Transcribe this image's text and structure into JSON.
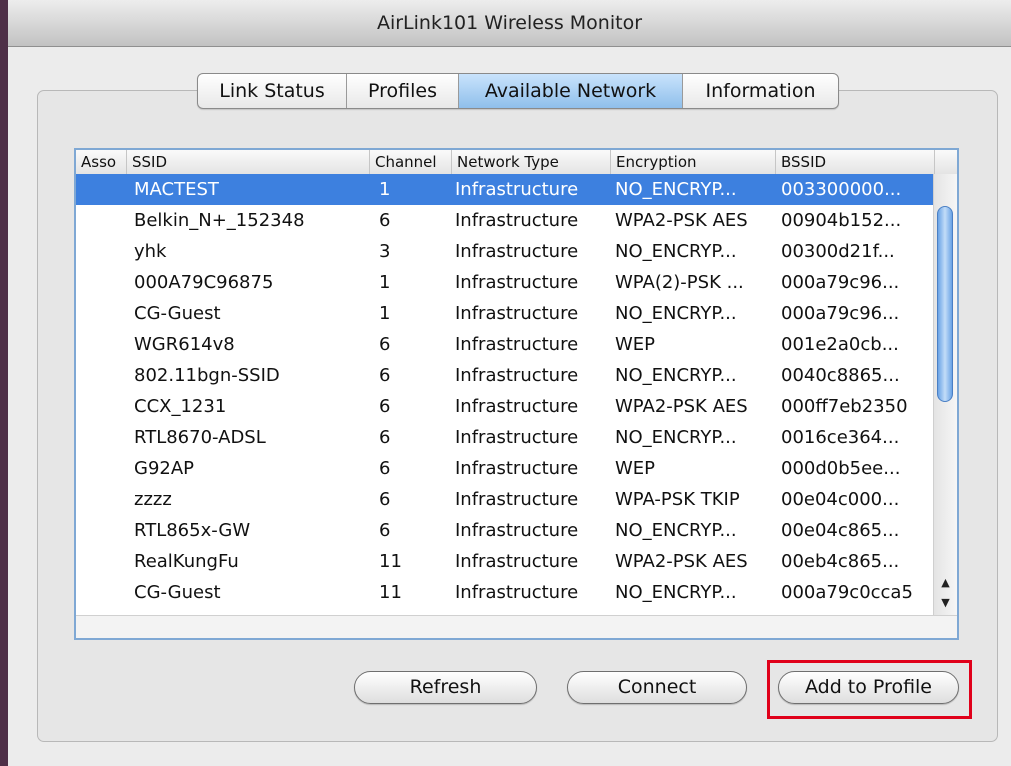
{
  "window": {
    "title": "AirLink101 Wireless Monitor"
  },
  "tabs": [
    {
      "label": "Link Status",
      "active": false
    },
    {
      "label": "Profiles",
      "active": false
    },
    {
      "label": "Available Network",
      "active": true
    },
    {
      "label": "Information",
      "active": false
    }
  ],
  "table": {
    "columns": [
      "Asso",
      "SSID",
      "Channel",
      "Network Type",
      "Encryption",
      "BSSID"
    ],
    "rows": [
      {
        "asso": "",
        "ssid": "MACTEST",
        "channel": "1",
        "type": "Infrastructure",
        "encryption": "NO_ENCRYP...",
        "bssid": "003300000...",
        "selected": true
      },
      {
        "asso": "",
        "ssid": "Belkin_N+_152348",
        "channel": "6",
        "type": "Infrastructure",
        "encryption": "WPA2-PSK AES",
        "bssid": "00904b152...",
        "selected": false
      },
      {
        "asso": "",
        "ssid": "yhk",
        "channel": "3",
        "type": "Infrastructure",
        "encryption": "NO_ENCRYP...",
        "bssid": "00300d21f...",
        "selected": false
      },
      {
        "asso": "",
        "ssid": "000A79C96875",
        "channel": "1",
        "type": "Infrastructure",
        "encryption": "WPA(2)-PSK ...",
        "bssid": "000a79c96...",
        "selected": false
      },
      {
        "asso": "",
        "ssid": "CG-Guest",
        "channel": "1",
        "type": "Infrastructure",
        "encryption": "NO_ENCRYP...",
        "bssid": "000a79c96...",
        "selected": false
      },
      {
        "asso": "",
        "ssid": " WGR614v8",
        "channel": "6",
        "type": "Infrastructure",
        "encryption": "WEP",
        "bssid": "001e2a0cb...",
        "selected": false
      },
      {
        "asso": "",
        "ssid": "802.11bgn-SSID",
        "channel": "6",
        "type": "Infrastructure",
        "encryption": "NO_ENCRYP...",
        "bssid": "0040c8865...",
        "selected": false
      },
      {
        "asso": "",
        "ssid": "CCX_1231",
        "channel": "6",
        "type": "Infrastructure",
        "encryption": "WPA2-PSK AES",
        "bssid": "000ff7eb2350",
        "selected": false
      },
      {
        "asso": "",
        "ssid": "RTL8670-ADSL",
        "channel": "6",
        "type": "Infrastructure",
        "encryption": "NO_ENCRYP...",
        "bssid": "0016ce364...",
        "selected": false
      },
      {
        "asso": "",
        "ssid": "G92AP",
        "channel": "6",
        "type": "Infrastructure",
        "encryption": "WEP",
        "bssid": "000d0b5ee...",
        "selected": false
      },
      {
        "asso": "",
        "ssid": "zzzz",
        "channel": "6",
        "type": "Infrastructure",
        "encryption": "WPA-PSK TKIP",
        "bssid": "00e04c000...",
        "selected": false
      },
      {
        "asso": "",
        "ssid": "RTL865x-GW",
        "channel": "6",
        "type": "Infrastructure",
        "encryption": "NO_ENCRYP...",
        "bssid": "00e04c865...",
        "selected": false
      },
      {
        "asso": "",
        "ssid": "RealKungFu",
        "channel": "11",
        "type": "Infrastructure",
        "encryption": "WPA2-PSK AES",
        "bssid": "00eb4c865...",
        "selected": false
      },
      {
        "asso": "",
        "ssid": "CG-Guest",
        "channel": "11",
        "type": "Infrastructure",
        "encryption": "NO_ENCRYP...",
        "bssid": "000a79c0cca5",
        "selected": false
      }
    ]
  },
  "buttons": {
    "refresh": "Refresh",
    "connect": "Connect",
    "add_to_profile": "Add to Profile"
  },
  "icons": {
    "scroll_up": "scroll-up-arrow-icon",
    "scroll_down": "scroll-down-arrow-icon"
  },
  "colors": {
    "selection": "#3d80df",
    "active_tab": "#a9d1f5",
    "highlight": "#e0001a",
    "table_border": "#7fa8d4"
  }
}
